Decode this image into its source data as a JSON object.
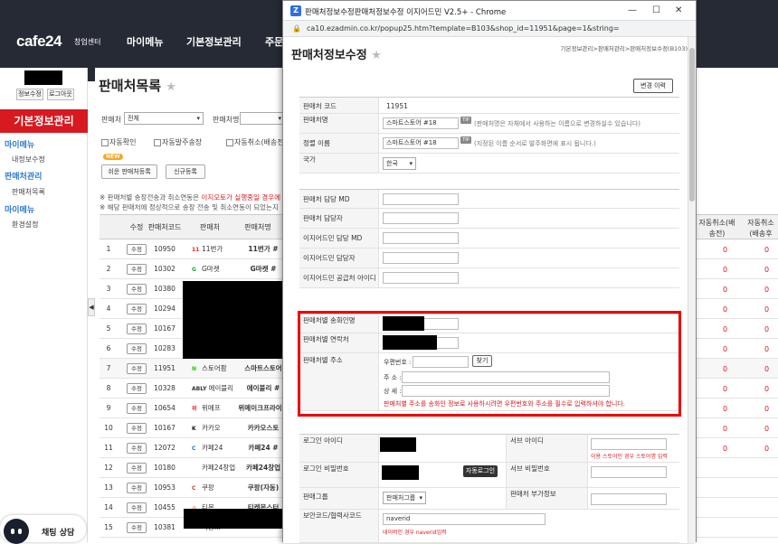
{
  "header": {
    "logo": "cafe24",
    "logo_sub": "창업센터",
    "nav": [
      "마이메뉴",
      "기본정보관리",
      "주문"
    ]
  },
  "sidebar": {
    "buttons": [
      "정보수정",
      "로그아웃"
    ],
    "title": "기본정보관리",
    "sections": [
      {
        "title": "마이메뉴",
        "items": [
          "내정보수정"
        ]
      },
      {
        "title": "판매처관리",
        "items": [
          "판매처목록"
        ]
      },
      {
        "title": "마이메뉴",
        "items": [
          "환경설정"
        ]
      }
    ]
  },
  "main": {
    "title": "판매처목록",
    "filters": {
      "vendor_label": "판매처",
      "vendor_value": "전체",
      "name_label": "판매처명",
      "checks": [
        "자동확인",
        "자동발주송장",
        "자동취소(배송전)"
      ]
    },
    "buttons": {
      "easy_register": "쉬운 판매처등록",
      "new_register": "신규등록",
      "new_badge": "NEW"
    },
    "notice": {
      "line1_prefix": "※ 판매처별 송장전송과 취소연동은 ",
      "line1_red": "이지오토가 실행중일 경우에만 ",
      "line2": "※ 해당 판매처에 정상적으로 송장 전송 및 취소연동이 되었는지 확인"
    },
    "table": {
      "headers": [
        "",
        "수정",
        "판매처코드",
        "판매처",
        "판매처명",
        "자동취소(배송전)",
        "자동취소(배송후"
      ],
      "edit_label": "수정",
      "rows": [
        {
          "no": "1",
          "code": "10950",
          "vendor": "11번가",
          "logo": "11",
          "logo_color": "#e8202a",
          "name": "11번가 #"
        },
        {
          "no": "2",
          "code": "10302",
          "vendor": "G마켓",
          "logo": "G",
          "logo_color": "#1fa33a",
          "name": "G마켓 #"
        },
        {
          "no": "3",
          "code": "10380",
          "vendor": "",
          "logo": "",
          "logo_color": "",
          "name": ""
        },
        {
          "no": "4",
          "code": "10294",
          "vendor": "",
          "logo": "",
          "logo_color": "",
          "name": ""
        },
        {
          "no": "5",
          "code": "10167",
          "vendor": "",
          "logo": "",
          "logo_color": "",
          "name": ""
        },
        {
          "no": "6",
          "code": "10283",
          "vendor": "",
          "logo": "",
          "logo_color": "",
          "name": ""
        },
        {
          "no": "7",
          "code": "11951",
          "vendor": "스토어팜",
          "logo": "N",
          "logo_color": "#1ec800",
          "name": "스마트스토어"
        },
        {
          "no": "8",
          "code": "10328",
          "vendor": "에이블리",
          "logo": "ABLY",
          "logo_color": "#333333",
          "name": "에이블리 #"
        },
        {
          "no": "9",
          "code": "10654",
          "vendor": "위메프",
          "logo": "위",
          "logo_color": "#e8202a",
          "name": "위메이크프라이스"
        },
        {
          "no": "10",
          "code": "10167",
          "vendor": "카카오",
          "logo": "K",
          "logo_color": "#111111",
          "name": "카카오스토"
        },
        {
          "no": "11",
          "code": "12072",
          "vendor": "카페24",
          "logo": "C",
          "logo_color": "#2a6ad9",
          "name": "카페24 #"
        },
        {
          "no": "12",
          "code": "10180",
          "vendor": "카페24창업센터",
          "logo": "",
          "logo_color": "",
          "name": "카페24창업"
        },
        {
          "no": "13",
          "code": "10953",
          "vendor": "쿠팡",
          "logo": "C",
          "logo_color": "#c73a2b",
          "name": "쿠팡(자동)"
        },
        {
          "no": "14",
          "code": "10455",
          "vendor": "티몬",
          "logo": "◎",
          "logo_color": "#ff4e00",
          "name": "티켓몬스터"
        },
        {
          "no": "15",
          "code": "10381",
          "vendor": "사용...",
          "logo": "",
          "logo_color": "",
          "name": ""
        }
      ],
      "zero": "0"
    }
  },
  "chat": {
    "label": "채팅 상담"
  },
  "popup": {
    "title": "판매처정보수정판매처정보수정 이지어드민 V2.5+ - Chrome",
    "url": "ca10.ezadmin.co.kr/popup25.htm?template=B103&shop_id=11951&page=1&string=",
    "heading": "판매처정보수정",
    "breadcrumb": "기본정보관리>판매처관리>판매처정보수정(B103)",
    "history_button": "변경 이력",
    "fields": {
      "code_label": "판매처 코드",
      "code_value": "11951",
      "name_label": "판매처명",
      "name_value": "스마트스토어 #18",
      "name_hint": "(판매처명은 자체에서 사용하는 이름으로 변경하실수 있습니다)",
      "alias_label": "정렬 이름",
      "alias_value": "스마트스토어 #18",
      "alias_hint": "(지정된 이름 순서로 발주화면에 표시 됩니다.)",
      "country_label": "국가",
      "country_value": "한국",
      "tip": "TIP",
      "md_label": "판매처 담당 MD",
      "manager_label": "판매처 담당자",
      "ez_md_label": "이지어드민 담당 MD",
      "ez_manager_label": "이지어드민 담당자",
      "ez_supplier_label": "이지어드민 공급처 아이디",
      "sender_label": "판매처별 송화인명",
      "contact_label": "판매처별 연락처",
      "address_label": "판매처별 주소",
      "zip_label": "우편번호 :",
      "find_button": "찾기",
      "addr_label": "주 소 :",
      "detail_label": "상 세 :",
      "address_warning": "판매처별 주소를 송화인 정보로 사용하시려면 우편번호와 주소를 필수로 입력하셔야 합니다.",
      "login_id_label": "로그인 아이디",
      "sub_id_label": "서브 아이디",
      "sub_id_hint": "이용 스토어인 경우 스토어명 입력",
      "login_pw_label": "로그인 비밀번호",
      "auto_login_button": "자동로그인",
      "sub_pw_label": "서브 비밀번호",
      "group_label": "판매그룹",
      "group_value": "판매처그룹",
      "extra_label": "판매처 부가정보",
      "security_label": "보안코드/협력사코드",
      "security_value": "naverid",
      "security_hint": "네이버인 경우 naverid입력"
    }
  }
}
